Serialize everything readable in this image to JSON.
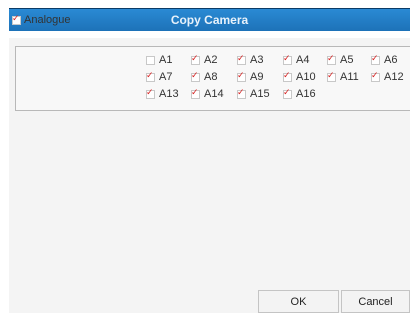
{
  "dialog": {
    "title": "Copy Camera"
  },
  "group": {
    "label": "Analogue",
    "checked": true
  },
  "channels": [
    {
      "label": "A1",
      "checked": false
    },
    {
      "label": "A2",
      "checked": true
    },
    {
      "label": "A3",
      "checked": true
    },
    {
      "label": "A4",
      "checked": true
    },
    {
      "label": "A5",
      "checked": true
    },
    {
      "label": "A6",
      "checked": true
    },
    {
      "label": "A7",
      "checked": true
    },
    {
      "label": "A8",
      "checked": true
    },
    {
      "label": "A9",
      "checked": true
    },
    {
      "label": "A10",
      "checked": true
    },
    {
      "label": "A11",
      "checked": true
    },
    {
      "label": "A12",
      "checked": true
    },
    {
      "label": "A13",
      "checked": true
    },
    {
      "label": "A14",
      "checked": true
    },
    {
      "label": "A15",
      "checked": true
    },
    {
      "label": "A16",
      "checked": true
    }
  ],
  "buttons": {
    "ok": "OK",
    "cancel": "Cancel"
  },
  "colors": {
    "title_bar": "#1d72b8",
    "checkmark": "#d62020"
  }
}
